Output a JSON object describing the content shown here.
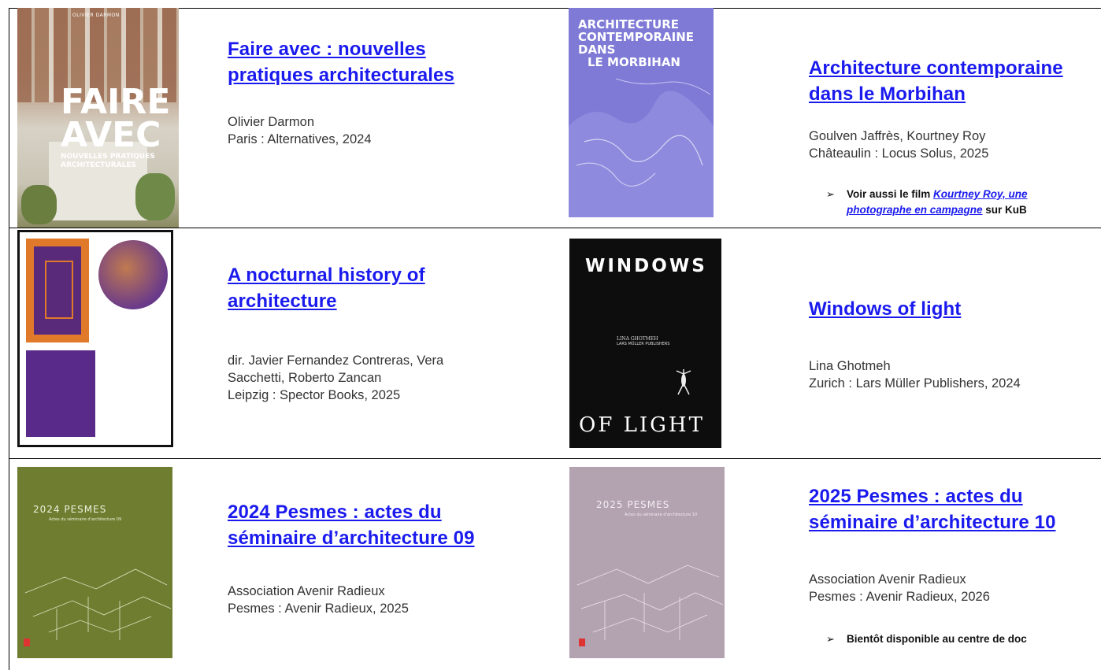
{
  "books": [
    {
      "title": "Faire avec : nouvelles pratiques architecturales",
      "title_lines": [
        "Faire avec : nouvelles",
        "pratiques architecturales"
      ],
      "author": "Olivier Darmon",
      "publisher": "Paris : Alternatives, 2024",
      "cover": {
        "top_text": "OLIVIER DARMON",
        "big_text": [
          "FAIRE",
          "AVEC"
        ],
        "sub_text": [
          "NOUVELLES PRATIQUES",
          "ARCHITECTURALES"
        ]
      }
    },
    {
      "title": "Architecture contemporaine dans le Morbihan",
      "title_lines": [
        "Architecture contemporaine",
        "dans le Morbihan"
      ],
      "author": "Goulven Jaffrès, Kourtney Roy",
      "publisher": "Châteaulin : Locus Solus, 2025",
      "note": {
        "prefix": "Voir aussi le film ",
        "link_lines": [
          "Kourtney Roy, une",
          "photographe en campagne"
        ],
        "suffix": " sur KuB"
      },
      "cover": {
        "lines": [
          "ARCHITECTURE",
          "CONTEMPORAINE",
          "DANS",
          "LE MORBIHAN"
        ]
      }
    },
    {
      "title": "A nocturnal history of architecture",
      "title_lines": [
        "A nocturnal history of",
        "architecture"
      ],
      "author_lines": [
        "dir. Javier Fernandez Contreras, Vera",
        "Sacchetti, Roberto Zancan"
      ],
      "publisher": "Leipzig : Spector Books, 2025"
    },
    {
      "title": "Windows of light",
      "title_lines": [
        "Windows of light"
      ],
      "author": "Lina Ghotmeh",
      "publisher": "Zurich : Lars Müller Publishers, 2024",
      "cover": {
        "top": "WINDOWS",
        "mid": [
          "LINA GHOTMEH",
          "LARS MÜLLER PUBLISHERS"
        ],
        "bottom": "OF LIGHT"
      }
    },
    {
      "title": "2024 Pesmes : actes du séminaire d’architecture 09",
      "title_lines": [
        "2024 Pesmes : actes du",
        "séminaire d’architecture 09"
      ],
      "author": "Association Avenir Radieux",
      "publisher": "Pesmes : Avenir Radieux, 2025",
      "cover": {
        "title": "2024  PESMES",
        "subtitle": "Actes du séminaire d'architecture 09"
      }
    },
    {
      "title": "2025 Pesmes : actes du séminaire d’architecture 10",
      "title_lines": [
        "2025 Pesmes : actes du",
        "séminaire d’architecture 10"
      ],
      "author": "Association Avenir Radieux",
      "publisher": "Pesmes : Avenir Radieux, 2026",
      "note": {
        "text": "Bientôt disponible au centre de doc"
      },
      "cover": {
        "title": "2025  PESMES",
        "subtitle": "Actes du séminaire d'architecture 10"
      }
    }
  ],
  "colors": {
    "link": "#1a1aee",
    "cover_olive": "#6e7d2f",
    "cover_mauve": "#b3a2b0",
    "cover_blue": "#7e7ad6"
  }
}
